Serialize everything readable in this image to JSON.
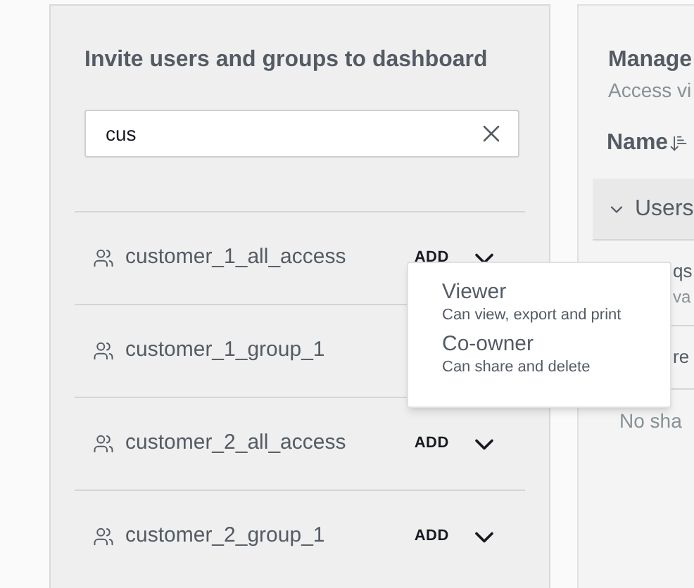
{
  "invite_panel": {
    "title": "Invite users and groups to dashboard",
    "search": {
      "value": "cus"
    },
    "results": [
      {
        "name": "customer_1_all_access",
        "action": "ADD"
      },
      {
        "name": "customer_1_group_1"
      },
      {
        "name": "customer_2_all_access",
        "action": "ADD"
      },
      {
        "name": "customer_2_group_1",
        "action": "ADD"
      }
    ]
  },
  "role_menu": {
    "options": [
      {
        "label": "Viewer",
        "description": "Can view, export and print"
      },
      {
        "label": "Co-owner",
        "description": "Can share and delete"
      }
    ]
  },
  "manage_panel": {
    "title": "Manage",
    "subtitle": "Access vi",
    "column": "Name",
    "group": {
      "label": "Users",
      "expanded": true
    },
    "rows": [
      {
        "line_1": "qs",
        "line_2": "va"
      },
      {
        "line_1": "re"
      }
    ],
    "empty": "No sha"
  }
}
